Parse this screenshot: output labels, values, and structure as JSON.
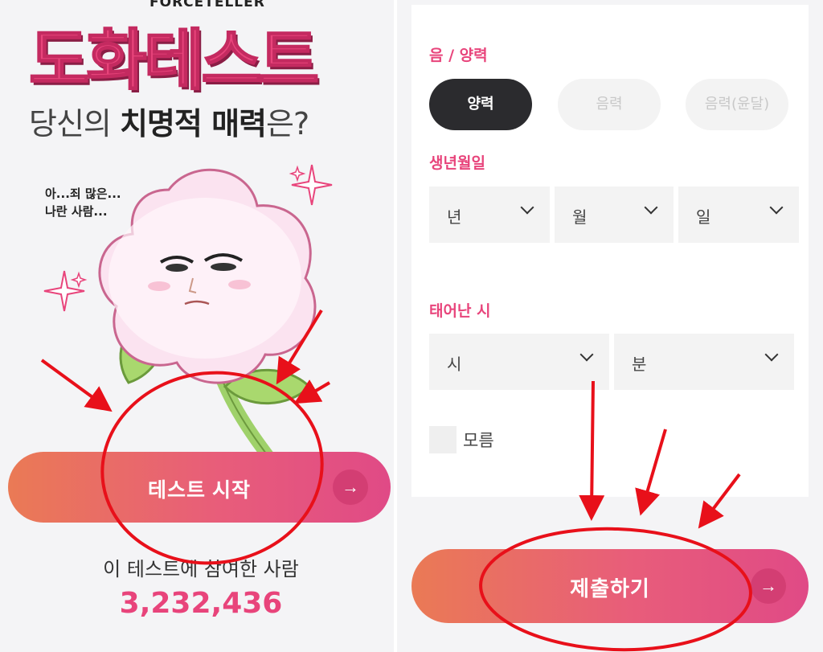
{
  "left": {
    "brand": "FORCETELLER",
    "title": "도화테스트",
    "subtitle_pre": "당신의 ",
    "subtitle_bold": "치명적 매력",
    "subtitle_post": "은?",
    "bubble_line1": "아...죄 많은...",
    "bubble_line2": "나란 사람...",
    "start_button": "테스트 시작",
    "arrow_glyph": "→",
    "participants_label": "이 테스트에 참여한 사람",
    "participants_count": "3,232,436"
  },
  "right": {
    "calendar_label": "음 / 양력",
    "calendar_options": [
      "양력",
      "음력",
      "음력(윤달)"
    ],
    "calendar_selected": "양력",
    "birth_label": "생년월일",
    "year_value": "년",
    "month_value": "월",
    "day_value": "일",
    "time_label": "태어난 시",
    "hour_value": "시",
    "minute_value": "분",
    "unknown_label": "모름",
    "submit_button": "제출하기",
    "arrow_glyph": "→"
  },
  "colors": {
    "accent_pink": "#e8447b",
    "button_gradient_start": "#ea7a55",
    "button_gradient_end": "#e04a86",
    "selected_pill": "#2b2b2e",
    "annotation_red": "#e8101a"
  },
  "icons": [
    "arrow-right-icon",
    "chevron-down-icon",
    "flower-character-icon",
    "sparkle-icon"
  ]
}
